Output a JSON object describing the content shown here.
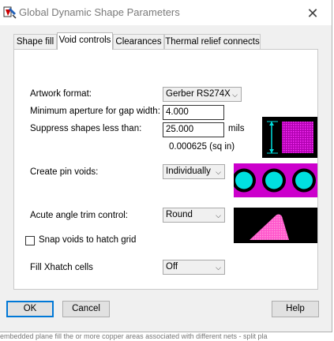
{
  "window": {
    "title": "Global Dynamic Shape Parameters",
    "icon": "app-shape-icon",
    "close_label": "✕"
  },
  "tabs": [
    {
      "label": "Shape fill"
    },
    {
      "label": "Void controls"
    },
    {
      "label": "Clearances"
    },
    {
      "label": "Thermal relief connects"
    }
  ],
  "active_tab": "Void controls",
  "form": {
    "artwork_format": {
      "label": "Artwork format:",
      "value": "Gerber RS274X"
    },
    "min_aperture": {
      "label": "Minimum aperture for gap width:",
      "value": "4.000"
    },
    "suppress_shapes": {
      "label": "Suppress shapes less than:",
      "value": "25.000",
      "unit": "mils",
      "area": "0.000625 (sq in)"
    },
    "create_pin_voids": {
      "label": "Create pin voids:",
      "value": "Individually"
    },
    "acute_angle_trim": {
      "label": "Acute angle trim control:",
      "value": "Round"
    },
    "snap_voids": {
      "label": "Snap voids to hatch grid",
      "checked": false
    },
    "fill_xhatch": {
      "label": "Fill Xhatch cells",
      "value": "Off"
    }
  },
  "buttons": {
    "ok": "OK",
    "cancel": "Cancel",
    "help": "Help"
  },
  "background_text": "embedded plane fill the or more copper areas associated with different nets - split pla",
  "colors": {
    "preview_black": "#000000",
    "magenta": "#cc00cc",
    "cyan": "#00e0e0",
    "pink": "#ff66cc"
  }
}
